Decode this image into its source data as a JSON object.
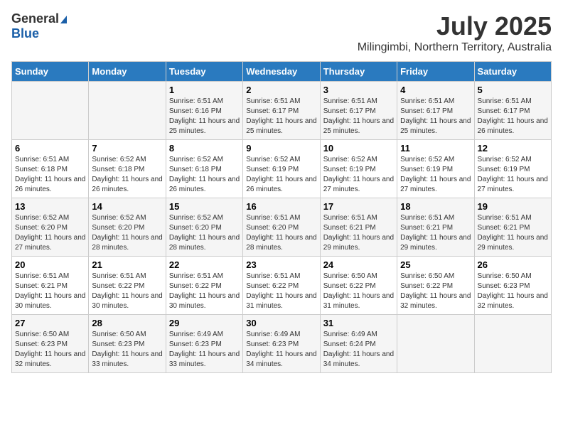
{
  "header": {
    "logo_general": "General",
    "logo_blue": "Blue",
    "month_year": "July 2025",
    "location": "Milingimbi, Northern Territory, Australia"
  },
  "days_of_week": [
    "Sunday",
    "Monday",
    "Tuesday",
    "Wednesday",
    "Thursday",
    "Friday",
    "Saturday"
  ],
  "weeks": [
    [
      {
        "day": "",
        "sunrise": "",
        "sunset": "",
        "daylight": ""
      },
      {
        "day": "",
        "sunrise": "",
        "sunset": "",
        "daylight": ""
      },
      {
        "day": "1",
        "sunrise": "Sunrise: 6:51 AM",
        "sunset": "Sunset: 6:16 PM",
        "daylight": "Daylight: 11 hours and 25 minutes."
      },
      {
        "day": "2",
        "sunrise": "Sunrise: 6:51 AM",
        "sunset": "Sunset: 6:17 PM",
        "daylight": "Daylight: 11 hours and 25 minutes."
      },
      {
        "day": "3",
        "sunrise": "Sunrise: 6:51 AM",
        "sunset": "Sunset: 6:17 PM",
        "daylight": "Daylight: 11 hours and 25 minutes."
      },
      {
        "day": "4",
        "sunrise": "Sunrise: 6:51 AM",
        "sunset": "Sunset: 6:17 PM",
        "daylight": "Daylight: 11 hours and 25 minutes."
      },
      {
        "day": "5",
        "sunrise": "Sunrise: 6:51 AM",
        "sunset": "Sunset: 6:17 PM",
        "daylight": "Daylight: 11 hours and 26 minutes."
      }
    ],
    [
      {
        "day": "6",
        "sunrise": "Sunrise: 6:51 AM",
        "sunset": "Sunset: 6:18 PM",
        "daylight": "Daylight: 11 hours and 26 minutes."
      },
      {
        "day": "7",
        "sunrise": "Sunrise: 6:52 AM",
        "sunset": "Sunset: 6:18 PM",
        "daylight": "Daylight: 11 hours and 26 minutes."
      },
      {
        "day": "8",
        "sunrise": "Sunrise: 6:52 AM",
        "sunset": "Sunset: 6:18 PM",
        "daylight": "Daylight: 11 hours and 26 minutes."
      },
      {
        "day": "9",
        "sunrise": "Sunrise: 6:52 AM",
        "sunset": "Sunset: 6:19 PM",
        "daylight": "Daylight: 11 hours and 26 minutes."
      },
      {
        "day": "10",
        "sunrise": "Sunrise: 6:52 AM",
        "sunset": "Sunset: 6:19 PM",
        "daylight": "Daylight: 11 hours and 27 minutes."
      },
      {
        "day": "11",
        "sunrise": "Sunrise: 6:52 AM",
        "sunset": "Sunset: 6:19 PM",
        "daylight": "Daylight: 11 hours and 27 minutes."
      },
      {
        "day": "12",
        "sunrise": "Sunrise: 6:52 AM",
        "sunset": "Sunset: 6:19 PM",
        "daylight": "Daylight: 11 hours and 27 minutes."
      }
    ],
    [
      {
        "day": "13",
        "sunrise": "Sunrise: 6:52 AM",
        "sunset": "Sunset: 6:20 PM",
        "daylight": "Daylight: 11 hours and 27 minutes."
      },
      {
        "day": "14",
        "sunrise": "Sunrise: 6:52 AM",
        "sunset": "Sunset: 6:20 PM",
        "daylight": "Daylight: 11 hours and 28 minutes."
      },
      {
        "day": "15",
        "sunrise": "Sunrise: 6:52 AM",
        "sunset": "Sunset: 6:20 PM",
        "daylight": "Daylight: 11 hours and 28 minutes."
      },
      {
        "day": "16",
        "sunrise": "Sunrise: 6:51 AM",
        "sunset": "Sunset: 6:20 PM",
        "daylight": "Daylight: 11 hours and 28 minutes."
      },
      {
        "day": "17",
        "sunrise": "Sunrise: 6:51 AM",
        "sunset": "Sunset: 6:21 PM",
        "daylight": "Daylight: 11 hours and 29 minutes."
      },
      {
        "day": "18",
        "sunrise": "Sunrise: 6:51 AM",
        "sunset": "Sunset: 6:21 PM",
        "daylight": "Daylight: 11 hours and 29 minutes."
      },
      {
        "day": "19",
        "sunrise": "Sunrise: 6:51 AM",
        "sunset": "Sunset: 6:21 PM",
        "daylight": "Daylight: 11 hours and 29 minutes."
      }
    ],
    [
      {
        "day": "20",
        "sunrise": "Sunrise: 6:51 AM",
        "sunset": "Sunset: 6:21 PM",
        "daylight": "Daylight: 11 hours and 30 minutes."
      },
      {
        "day": "21",
        "sunrise": "Sunrise: 6:51 AM",
        "sunset": "Sunset: 6:22 PM",
        "daylight": "Daylight: 11 hours and 30 minutes."
      },
      {
        "day": "22",
        "sunrise": "Sunrise: 6:51 AM",
        "sunset": "Sunset: 6:22 PM",
        "daylight": "Daylight: 11 hours and 30 minutes."
      },
      {
        "day": "23",
        "sunrise": "Sunrise: 6:51 AM",
        "sunset": "Sunset: 6:22 PM",
        "daylight": "Daylight: 11 hours and 31 minutes."
      },
      {
        "day": "24",
        "sunrise": "Sunrise: 6:50 AM",
        "sunset": "Sunset: 6:22 PM",
        "daylight": "Daylight: 11 hours and 31 minutes."
      },
      {
        "day": "25",
        "sunrise": "Sunrise: 6:50 AM",
        "sunset": "Sunset: 6:22 PM",
        "daylight": "Daylight: 11 hours and 32 minutes."
      },
      {
        "day": "26",
        "sunrise": "Sunrise: 6:50 AM",
        "sunset": "Sunset: 6:23 PM",
        "daylight": "Daylight: 11 hours and 32 minutes."
      }
    ],
    [
      {
        "day": "27",
        "sunrise": "Sunrise: 6:50 AM",
        "sunset": "Sunset: 6:23 PM",
        "daylight": "Daylight: 11 hours and 32 minutes."
      },
      {
        "day": "28",
        "sunrise": "Sunrise: 6:50 AM",
        "sunset": "Sunset: 6:23 PM",
        "daylight": "Daylight: 11 hours and 33 minutes."
      },
      {
        "day": "29",
        "sunrise": "Sunrise: 6:49 AM",
        "sunset": "Sunset: 6:23 PM",
        "daylight": "Daylight: 11 hours and 33 minutes."
      },
      {
        "day": "30",
        "sunrise": "Sunrise: 6:49 AM",
        "sunset": "Sunset: 6:23 PM",
        "daylight": "Daylight: 11 hours and 34 minutes."
      },
      {
        "day": "31",
        "sunrise": "Sunrise: 6:49 AM",
        "sunset": "Sunset: 6:24 PM",
        "daylight": "Daylight: 11 hours and 34 minutes."
      },
      {
        "day": "",
        "sunrise": "",
        "sunset": "",
        "daylight": ""
      },
      {
        "day": "",
        "sunrise": "",
        "sunset": "",
        "daylight": ""
      }
    ]
  ]
}
